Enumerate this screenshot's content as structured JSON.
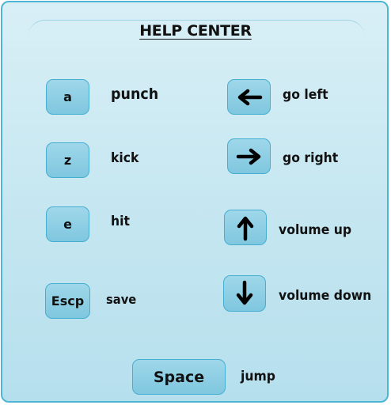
{
  "title": "HELP CENTER",
  "left_controls": [
    {
      "key": "a",
      "action": "punch"
    },
    {
      "key": "z",
      "action": "kick"
    },
    {
      "key": "e",
      "action": "hit"
    },
    {
      "key": "Escp",
      "action": "save"
    }
  ],
  "right_controls": [
    {
      "icon": "arrow-left-icon",
      "action": "go left"
    },
    {
      "icon": "arrow-right-icon",
      "action": "go right"
    },
    {
      "icon": "arrow-up-icon",
      "action": "volume up"
    },
    {
      "icon": "arrow-down-icon",
      "action": "volume down"
    }
  ],
  "bottom_control": {
    "key": "Space",
    "action": "jump"
  },
  "colors": {
    "panel_border": "#4eb6d4",
    "panel_bg": "#c6e7f1",
    "key_fill": "#8fcfe5",
    "key_border": "#46aed0"
  }
}
